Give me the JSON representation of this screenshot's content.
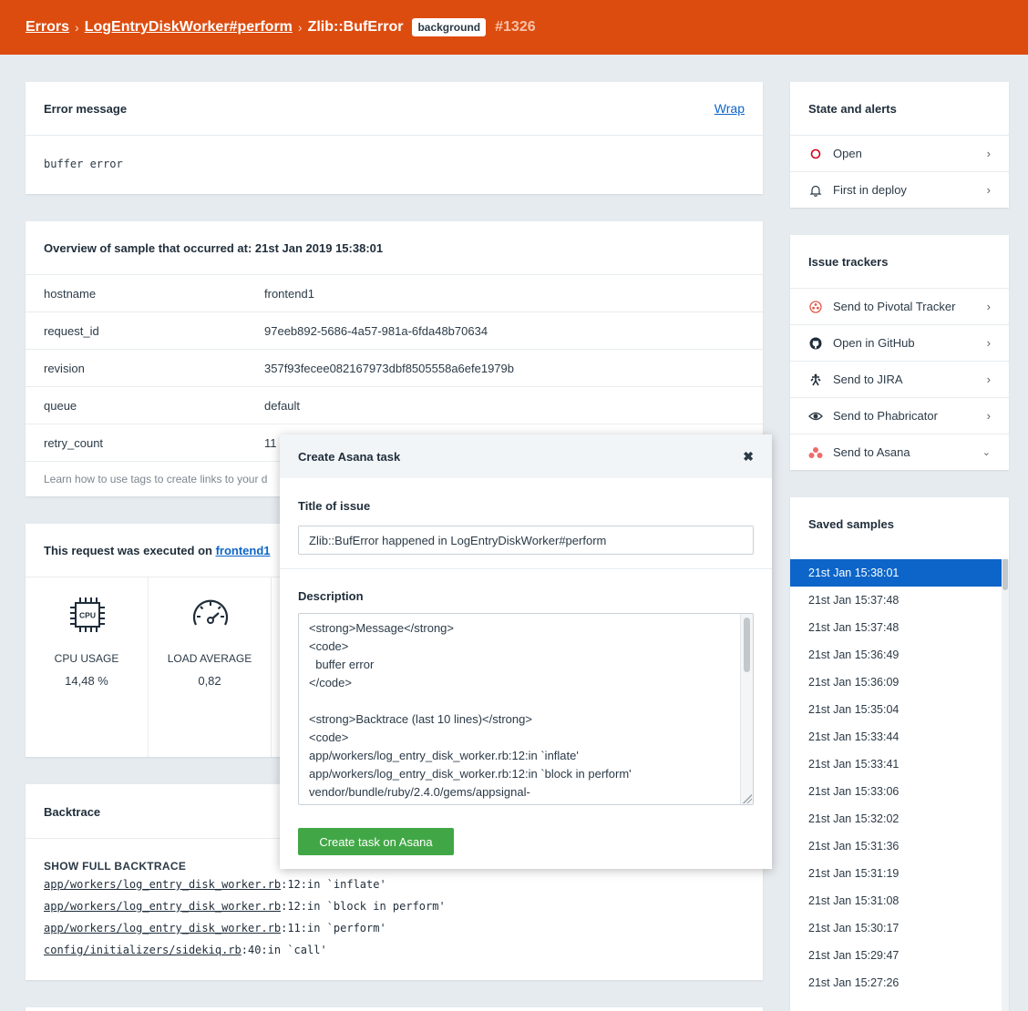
{
  "breadcrumb": {
    "errors": "Errors",
    "action": "LogEntryDiskWorker#perform",
    "error_class": "Zlib::BufError",
    "tag": "background",
    "issue_number": "#1326"
  },
  "error_message": {
    "title": "Error message",
    "wrap_link": "Wrap",
    "message": "buffer error"
  },
  "overview": {
    "title": "Overview of sample that occurred at: 21st Jan 2019 15:38:01",
    "rows": [
      {
        "key": "hostname",
        "value": "frontend1"
      },
      {
        "key": "request_id",
        "value": "97eeb892-5686-4a57-981a-6fda48b70634"
      },
      {
        "key": "revision",
        "value": "357f93fecee082167973dbf8505558a6efe1979b"
      },
      {
        "key": "queue",
        "value": "default"
      },
      {
        "key": "retry_count",
        "value": "11"
      }
    ],
    "footer_text": "Learn how to use tags to create links to your d"
  },
  "host_metrics": {
    "title_prefix": "This request was executed on ",
    "host_link": "frontend1",
    "metrics": [
      {
        "label": "CPU USAGE",
        "value": "14,48 %",
        "icon": "cpu-icon"
      },
      {
        "label": "LOAD AVERAGE",
        "value": "0,82",
        "icon": "gauge-icon"
      }
    ]
  },
  "backtrace": {
    "title": "Backtrace",
    "show_full": "SHOW FULL BACKTRACE",
    "lines": [
      {
        "file": "app/workers/log_entry_disk_worker.rb",
        "rest": ":12:in `inflate'"
      },
      {
        "file": "app/workers/log_entry_disk_worker.rb",
        "rest": ":12:in `block in perform'"
      },
      {
        "file": "app/workers/log_entry_disk_worker.rb",
        "rest": ":11:in `perform'"
      },
      {
        "file": "config/initializers/sidekiq.rb",
        "rest": ":40:in `call'"
      }
    ]
  },
  "state_alerts": {
    "title": "State and alerts",
    "items": [
      {
        "label": "Open",
        "icon": "open-circle-icon"
      },
      {
        "label": "First in deploy",
        "icon": "bell-icon"
      }
    ]
  },
  "issue_trackers": {
    "title": "Issue trackers",
    "items": [
      {
        "label": "Send to Pivotal Tracker",
        "icon": "pivotal-tracker-icon"
      },
      {
        "label": "Open in GitHub",
        "icon": "github-icon"
      },
      {
        "label": "Send to JIRA",
        "icon": "jira-icon"
      },
      {
        "label": "Send to Phabricator",
        "icon": "phabricator-icon"
      },
      {
        "label": "Send to Asana",
        "icon": "asana-icon"
      }
    ]
  },
  "saved_samples": {
    "title": "Saved samples",
    "items": [
      "21st Jan 15:38:01",
      "21st Jan 15:37:48",
      "21st Jan 15:37:48",
      "21st Jan 15:36:49",
      "21st Jan 15:36:09",
      "21st Jan 15:35:04",
      "21st Jan 15:33:44",
      "21st Jan 15:33:41",
      "21st Jan 15:33:06",
      "21st Jan 15:32:02",
      "21st Jan 15:31:36",
      "21st Jan 15:31:19",
      "21st Jan 15:31:08",
      "21st Jan 15:30:17",
      "21st Jan 15:29:47",
      "21st Jan 15:27:26"
    ],
    "selected_index": 0
  },
  "asana_modal": {
    "title": "Create Asana task",
    "close_symbol": "✖",
    "title_label": "Title of issue",
    "title_value": "Zlib::BufError happened in LogEntryDiskWorker#perform",
    "description_label": "Description",
    "description_value": "<strong>Message</strong>\n<code>\n  buffer error\n</code>\n\n<strong>Backtrace (last 10 lines)</strong>\n<code>\napp/workers/log_entry_disk_worker.rb:12:in `inflate'\napp/workers/log_entry_disk_worker.rb:12:in `block in perform'\nvendor/bundle/ruby/2.4.0/gems/appsignal-",
    "submit_label": "Create task on Asana"
  },
  "colors": {
    "header": "#dd4c0f",
    "selected": "#0d65c9",
    "submit": "#41a746",
    "open_state": "#d0021b"
  }
}
